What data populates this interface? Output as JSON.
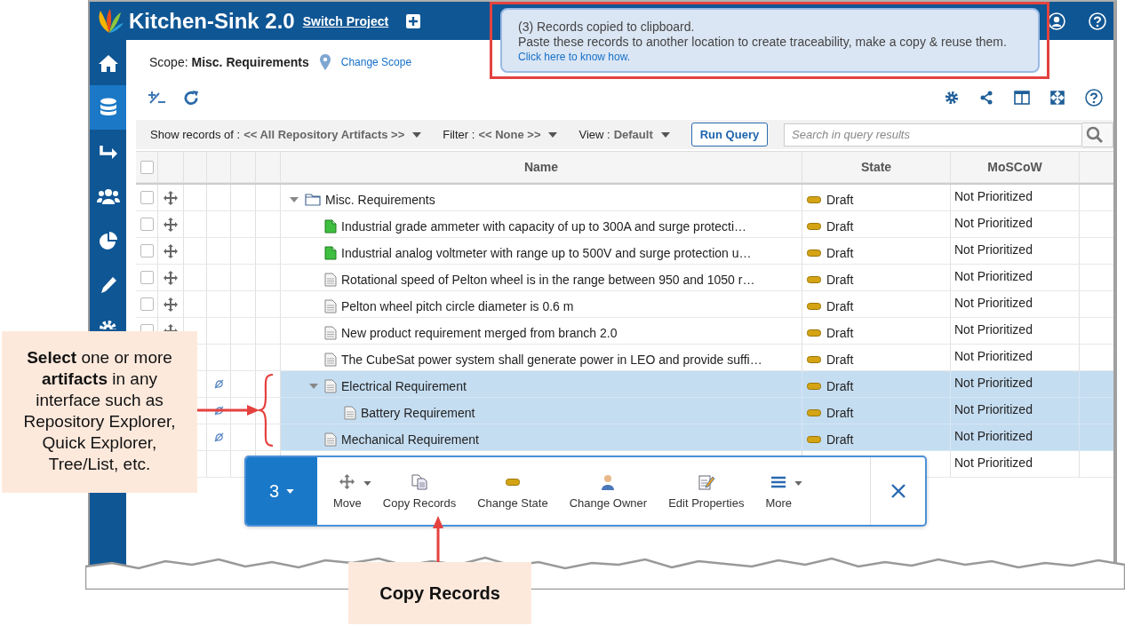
{
  "header": {
    "title": "Kitchen-Sink 2.0",
    "switch_link": "Switch Project"
  },
  "sidebar": {
    "items": [
      {
        "kind": "home",
        "selected": false
      },
      {
        "kind": "database",
        "selected": true
      },
      {
        "kind": "arrow",
        "selected": false
      },
      {
        "kind": "users",
        "selected": false
      },
      {
        "kind": "pie",
        "selected": false
      },
      {
        "kind": "pen",
        "selected": false
      },
      {
        "kind": "gear",
        "selected": false
      }
    ]
  },
  "toast": {
    "title": "(3) Records copied to clipboard.",
    "message": "Paste these records to another location to create traceability, make a copy & reuse them.",
    "link": "Click here to know how."
  },
  "scope": {
    "text": "Scope: **Misc. Requirements**",
    "link": "Change Scope"
  },
  "query_bar": {
    "fields": [
      {
        "label": "Show records of :",
        "value": "<< All Repository Artifacts >>"
      },
      {
        "label": "Filter :",
        "value": "<< None >>"
      },
      {
        "label": "View :",
        "value": "Default"
      }
    ],
    "run_button": "Run Query",
    "search": {
      "placeholder": "Search in query results"
    }
  },
  "table": {
    "header_checked": false,
    "columns": [
      "Name",
      "State",
      "MoSCoW"
    ],
    "rows": [
      {
        "name": "Misc. Requirements",
        "kind": "folder",
        "state": "Draft",
        "moscow": "Not Prioritized",
        "checked": false,
        "selected": false,
        "marker": false,
        "expanded": true,
        "children": [
          {
            "name": "Industrial grade ammeter with capacity of up to 300A and surge protecti…",
            "kind": "requirement",
            "state": "Draft",
            "moscow": "Not Prioritized",
            "checked": false,
            "selected": false,
            "marker": false
          },
          {
            "name": "Industrial analog voltmeter with range up to 500V and surge protection u…",
            "kind": "requirement",
            "state": "Draft",
            "moscow": "Not Prioritized",
            "checked": false,
            "selected": false,
            "marker": false
          },
          {
            "name": "Rotational speed of Pelton wheel is in the range between 950 and 1050 r…",
            "kind": "document",
            "state": "Draft",
            "moscow": "Not Prioritized",
            "checked": false,
            "selected": false,
            "marker": false
          },
          {
            "name": "Pelton wheel pitch circle diameter is 0.6 m",
            "kind": "document",
            "state": "Draft",
            "moscow": "Not Prioritized",
            "checked": false,
            "selected": false,
            "marker": false
          },
          {
            "name": "New product requirement merged from branch 2.0",
            "kind": "document",
            "state": "Draft",
            "moscow": "Not Prioritized",
            "checked": false,
            "selected": false,
            "marker": false
          },
          {
            "name": "The CubeSat power system shall generate power in LEO and provide suffi…",
            "kind": "document",
            "state": "Draft",
            "moscow": "Not Prioritized",
            "selected": false,
            "marker": false
          },
          {
            "name": "Electrical Requirement",
            "kind": "document",
            "state": "Draft",
            "moscow": "Not Prioritized",
            "selected": true,
            "marker": true,
            "expanded": true,
            "children": [
              {
                "name": "Battery Requirement",
                "kind": "document",
                "state": "Draft",
                "moscow": "Not Prioritized",
                "selected": true,
                "marker": true
              }
            ]
          },
          {
            "name": "Mechanical Requirement",
            "kind": "document",
            "state": "Draft",
            "moscow": "Not Prioritized",
            "selected": true,
            "marker": true
          },
          {
            "moscow": "Not Prioritized"
          }
        ]
      }
    ]
  },
  "action_bar": {
    "count": "3",
    "actions": [
      {
        "label": "Move",
        "kind": "move",
        "dropdown": true
      },
      {
        "label": "Copy Records",
        "kind": "copy",
        "dropdown": false
      },
      {
        "label": "Change State",
        "kind": "state",
        "dropdown": false
      },
      {
        "label": "Change Owner",
        "kind": "owner",
        "dropdown": false
      },
      {
        "label": "Edit Properties",
        "kind": "edit",
        "dropdown": false
      },
      {
        "label": "More",
        "kind": "more",
        "dropdown": true
      }
    ]
  },
  "callouts": {
    "select_note": "**Select** one or more **artifacts** in any interface such as Repository Explorer, Quick Explorer, Tree/List, etc.",
    "copy_note": "Copy Records"
  }
}
